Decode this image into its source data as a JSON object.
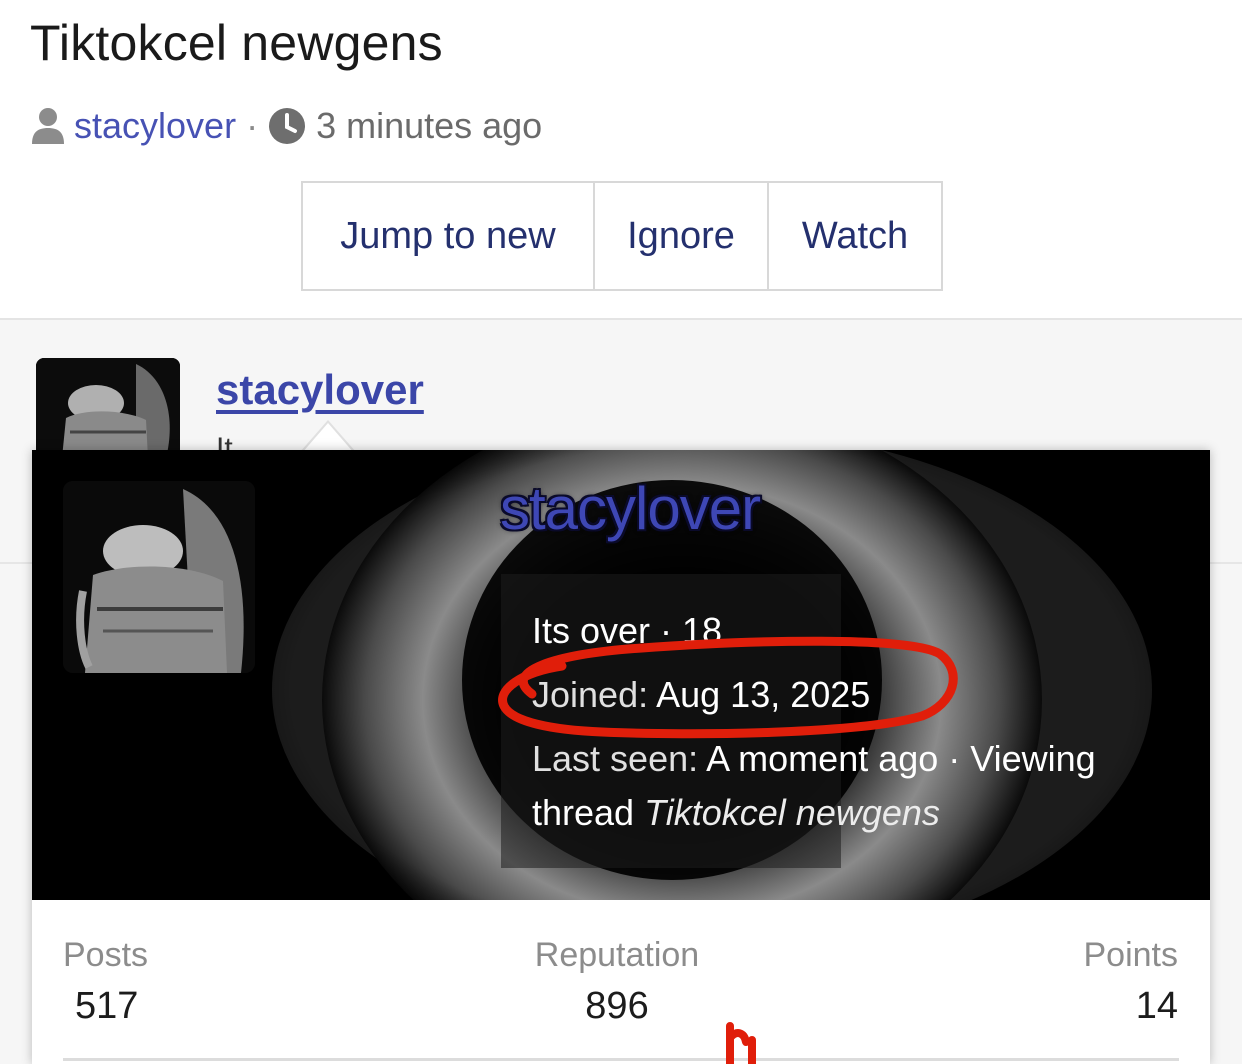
{
  "thread": {
    "title": "Tiktokcel newgens",
    "author": "stacylover",
    "separator": "·",
    "time": "3 minutes ago"
  },
  "buttons": {
    "jump_label": "Jump to new",
    "ignore_label": "Ignore",
    "watch_label": "Watch"
  },
  "post": {
    "username": "stacylover",
    "snippet": "It..."
  },
  "card": {
    "username": "stacylover",
    "title_line": "Its over · 18",
    "joined_label": "Joined:",
    "joined_value": "Aug 13, 2025",
    "last_seen_label": "Last seen:",
    "last_seen_value": "A moment ago · Viewing",
    "thread_prefix": "thread",
    "thread_name": "Tiktokcel newgens"
  },
  "stats": {
    "posts_label": "Posts",
    "posts_value": "517",
    "reputation_label": "Reputation",
    "reputation_value": "896",
    "points_label": "Points",
    "points_value": "14"
  },
  "colors": {
    "link": "#4752b4",
    "button_text": "#24306e",
    "annotation": "#e01e0a"
  },
  "icons": {
    "author": "user-icon",
    "time": "clock-icon"
  }
}
